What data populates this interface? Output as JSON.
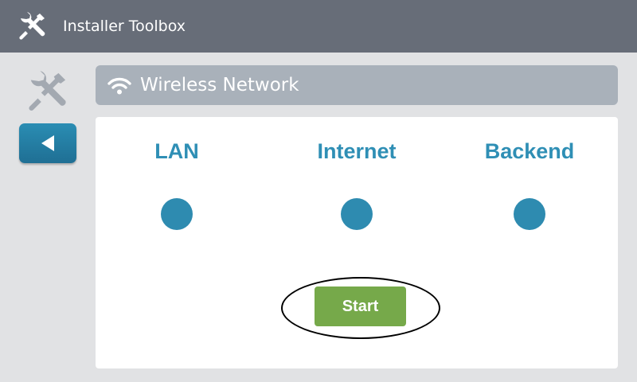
{
  "header": {
    "title": "Installer Toolbox",
    "logo_icon": "tools-icon"
  },
  "sidebar": {
    "tools_icon": "tools-icon",
    "back_icon": "back-arrow-icon"
  },
  "section": {
    "icon": "wifi-icon",
    "title": "Wireless Network"
  },
  "status": [
    {
      "label": "LAN",
      "indicator_color": "#2e8bb0"
    },
    {
      "label": "Internet",
      "indicator_color": "#2e8bb0"
    },
    {
      "label": "Backend",
      "indicator_color": "#2e8bb0"
    }
  ],
  "actions": {
    "start_label": "Start",
    "start_color": "#76a94a"
  },
  "colors": {
    "topbar": "#676d78",
    "background": "#e1e2e4",
    "accent": "#2f8fb5",
    "section_header": "#a9b1ba"
  }
}
